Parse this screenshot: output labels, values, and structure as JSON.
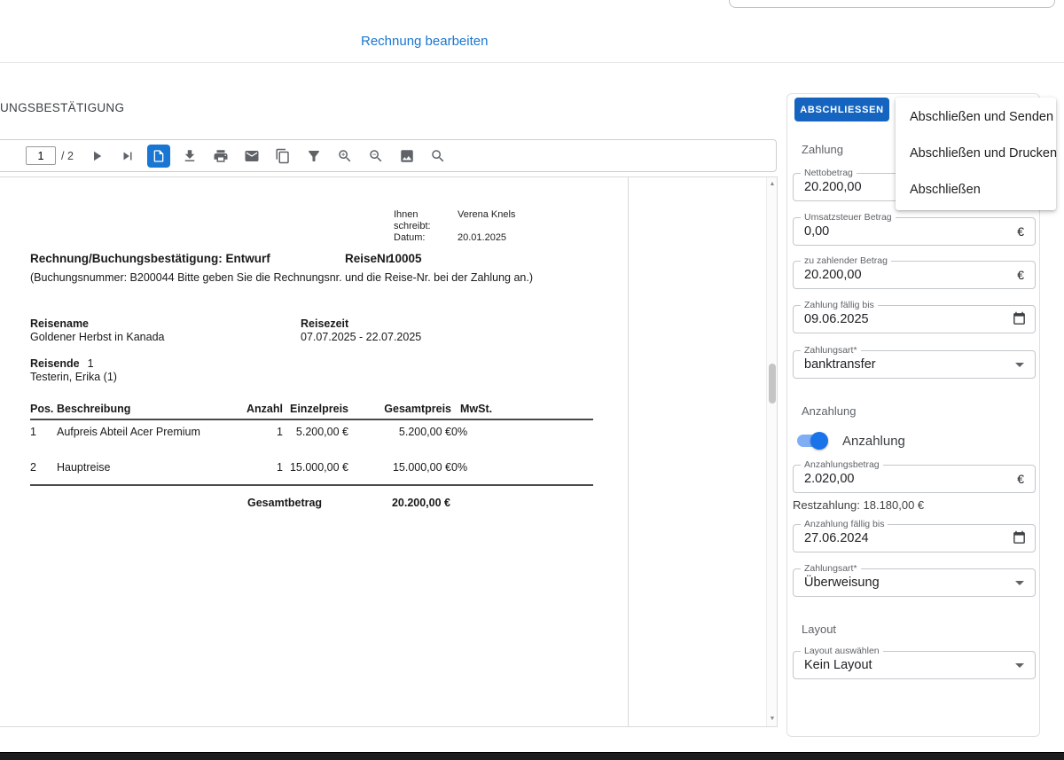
{
  "colors": {
    "accent": "#1565c0",
    "link": "#1976d2",
    "toggle": "#1a73e8"
  },
  "header": {
    "title": "Rechnung bearbeiten"
  },
  "doc_panel": {
    "title": "UNGSBESTÄTIGUNG",
    "toolbar": {
      "page_value": "1",
      "page_total": "/ 2",
      "icons": [
        "next-page",
        "last-page",
        "page-view",
        "download",
        "print",
        "email",
        "copy",
        "filter",
        "zoom-in",
        "zoom-out",
        "image",
        "search"
      ]
    },
    "pdf": {
      "sender_label": "Ihnen schreibt:",
      "sender_value": "Verena Knels",
      "date_label": "Datum:",
      "date_value": "20.01.2025",
      "title": "Rechnung/Buchungsbestätigung: Entwurf",
      "trip_no_label": "ReiseNr.",
      "trip_no_value": "10005",
      "note": "(Buchungsnummer: B200044 Bitte geben Sie die Rechnungsnr. und die Reise-Nr. bei der Zahlung an.)",
      "trip_name_label": "Reisename",
      "trip_name_value": "Goldener Herbst in Kanada",
      "trip_time_label": "Reisezeit",
      "trip_time_value": "07.07.2025  -  22.07.2025",
      "travelers_label": "Reisende",
      "travelers_count": "1",
      "traveler_name": "Testerin, Erika (1)",
      "table": {
        "headers": [
          "Pos.",
          "Beschreibung",
          "Anzahl",
          "Einzelpreis",
          "Gesamtpreis",
          "MwSt."
        ],
        "rows": [
          [
            "1",
            "Aufpreis Abteil Acer Premium",
            "1",
            "5.200,00 €",
            "5.200,00 €",
            "0%"
          ],
          [
            "2",
            "Hauptreise",
            "1",
            "15.000,00 €",
            "15.000,00 €",
            "0%"
          ]
        ],
        "total_label": "Gesamtbetrag",
        "total_value": "20.200,00 €"
      }
    }
  },
  "sidebar": {
    "finish_button_label": "ABSCHLIESSEN",
    "menu_items": [
      "Abschließen und Senden",
      "Abschließen und Drucken",
      "Abschließen"
    ],
    "payment": {
      "section_label": "Zahlung",
      "fields": [
        {
          "label": "Nettobetrag",
          "value": "20.200,00",
          "suffix": "€"
        },
        {
          "label": "Umsatzsteuer Betrag",
          "value": "0,00",
          "suffix": "€"
        },
        {
          "label": "zu zahlender Betrag",
          "value": "20.200,00",
          "suffix": "€"
        },
        {
          "label": "Zahlung fällig bis",
          "value": "09.06.2025"
        },
        {
          "label": "Zahlungsart*",
          "value": "banktransfer"
        }
      ]
    },
    "deposit": {
      "section_label": "Anzahlung",
      "toggle_label": "Anzahlung",
      "toggle_state": "on",
      "remainder_text": "Restzahlung: 18.180,00 €",
      "fields": [
        {
          "label": "Anzahlungsbetrag",
          "value": "2.020,00",
          "suffix": "€"
        },
        {
          "label": "Anzahlung fällig bis",
          "value": "27.06.2024"
        },
        {
          "label": "Zahlungsart*",
          "value": "Überweisung"
        }
      ]
    },
    "layout": {
      "section_label": "Layout",
      "fields": [
        {
          "label": "Layout auswählen",
          "value": "Kein Layout"
        }
      ]
    }
  }
}
